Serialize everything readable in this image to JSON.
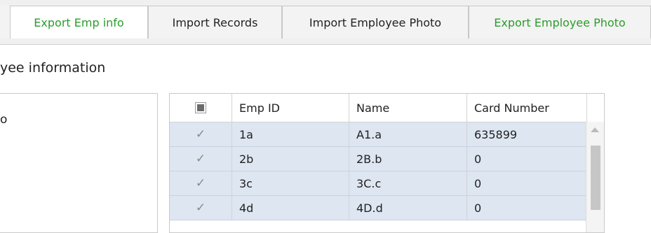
{
  "tabs": [
    {
      "label": "Export Emp info",
      "color": "#2a9d2a",
      "active": true
    },
    {
      "label": "Import Records",
      "color": "#222222",
      "active": false
    },
    {
      "label": "Import Employee Photo",
      "color": "#222222",
      "active": false
    },
    {
      "label": "Export Employee Photo",
      "color": "#2a9d2a",
      "active": false
    }
  ],
  "section_title": "yee information",
  "left_panel_text": "o",
  "grid": {
    "columns": [
      "Emp ID",
      "Name",
      "Card Number"
    ],
    "rows": [
      {
        "checked": "✓",
        "emp_id": "1a",
        "name": "A1.a",
        "card": "635899"
      },
      {
        "checked": "✓",
        "emp_id": "2b",
        "name": "2B.b",
        "card": "0"
      },
      {
        "checked": "✓",
        "emp_id": "3c",
        "name": "3C.c",
        "card": "0"
      },
      {
        "checked": "✓",
        "emp_id": "4d",
        "name": "4D.d",
        "card": "0"
      }
    ]
  }
}
